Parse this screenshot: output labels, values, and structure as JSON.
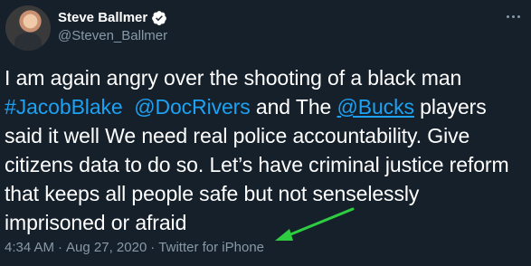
{
  "author": {
    "display_name": "Steve Ballmer",
    "handle": "@Steven_Ballmer",
    "verified": true
  },
  "tweet": {
    "segments": [
      {
        "text": "I am again angry over the shooting of a black man ",
        "type": "plain"
      },
      {
        "text": "#JacobBlake",
        "type": "link"
      },
      {
        "text": "  ",
        "type": "plain"
      },
      {
        "text": "@DocRivers",
        "type": "link"
      },
      {
        "text": " and The ",
        "type": "plain"
      },
      {
        "text": "@Bucks",
        "type": "link-underlined"
      },
      {
        "text": " players said it well We need real police accountability. Give citizens data to do so. Let’s have criminal justice reform that keeps all people safe but not senselessly imprisoned or afraid",
        "type": "plain"
      }
    ]
  },
  "meta": {
    "time": "4:34 AM",
    "separator1": "·",
    "date": "Aug 27, 2020",
    "separator2": "·",
    "source": "Twitter for iPhone"
  },
  "icons": {
    "verified": "verified-badge-icon",
    "more": "more-options-icon",
    "annotation": "green-arrow-icon"
  },
  "colors": {
    "background": "#15202b",
    "text": "#ffffff",
    "secondary": "#8899a6",
    "link": "#1da1f2",
    "annotation_arrow": "#2ecc40"
  }
}
